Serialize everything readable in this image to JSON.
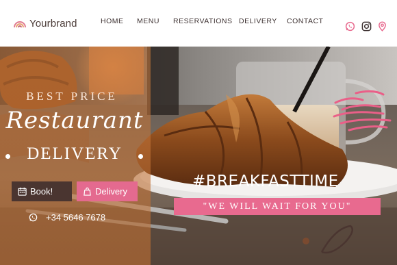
{
  "brand": {
    "name": "Yourbrand"
  },
  "nav": {
    "items": [
      {
        "label": "HOME"
      },
      {
        "label": "MENU"
      },
      {
        "label": "RESERVATIONS"
      },
      {
        "label": "DELIVERY"
      },
      {
        "label": "CONTACT"
      }
    ]
  },
  "social": {
    "icons": [
      "whatsapp-icon",
      "instagram-icon",
      "location-pin-icon"
    ],
    "color": "#e86a8f"
  },
  "hero": {
    "kicker": "BEST PRICE",
    "title": "Restaurant",
    "subtitle": "DELIVERY",
    "book_label": "Book!",
    "delivery_label": "Delivery",
    "phone": "+34 5646 7678",
    "hashtag": "#BREAKFASTTIME",
    "tagline": "\"WE WILL WAIT FOR YOU\""
  },
  "colors": {
    "accent": "#e86a8f",
    "dark": "#4a3530",
    "panel": "#c8783c"
  }
}
